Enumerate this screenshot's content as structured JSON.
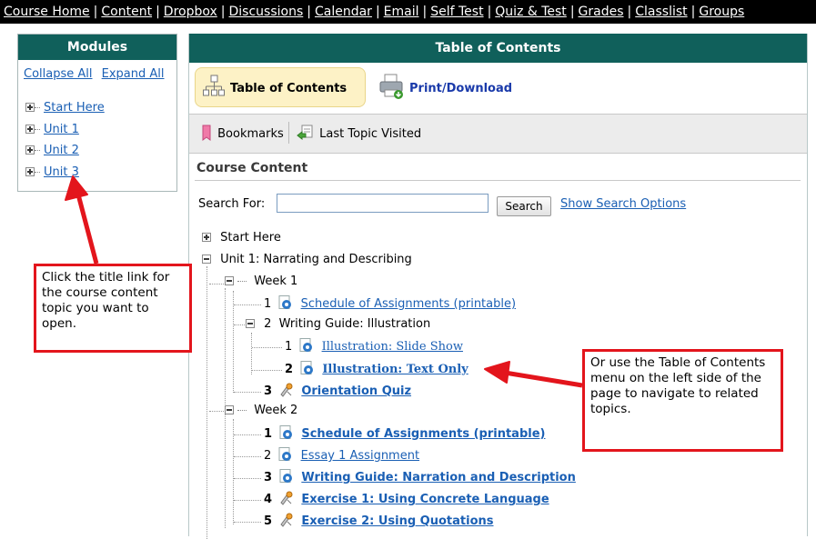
{
  "topnav": {
    "items": [
      "Course Home",
      "Content",
      "Dropbox",
      "Discussions",
      "Calendar",
      "Email",
      "Self Test",
      "Quiz & Test",
      "Grades",
      "Classlist",
      "Groups"
    ]
  },
  "modules": {
    "title": "Modules",
    "collapse_label": "Collapse All",
    "expand_label": "Expand All",
    "items": [
      "Start Here",
      "Unit 1",
      "Unit 2",
      "Unit 3"
    ]
  },
  "toc": {
    "title": "Table of Contents",
    "tab_active_label": "Table of Contents",
    "print_label": "Print/Download",
    "bookmarks_label": "Bookmarks",
    "last_topic_label": "Last Topic Visited",
    "section_title": "Course Content",
    "search_label": "Search For:",
    "search_value": "",
    "search_button": "Search",
    "search_options": "Show Search Options"
  },
  "tree": {
    "start_here": "Start Here",
    "unit1": "Unit 1: Narrating and Describing",
    "week1": "Week 1",
    "week1_items": [
      {
        "num": "1",
        "label": "Schedule of Assignments (printable)"
      },
      {
        "num": "2",
        "label": "Writing Guide: Illustration"
      }
    ],
    "illustration_items": [
      {
        "num": "1",
        "label": "Illustration: Slide Show"
      },
      {
        "num": "2",
        "label": "Illustration: Text Only"
      }
    ],
    "week1_item3": {
      "num": "3",
      "label": "Orientation Quiz"
    },
    "week2": "Week 2",
    "week2_items": [
      {
        "num": "1",
        "label": "Schedule of Assignments (printable)"
      },
      {
        "num": "2",
        "label": "Essay 1 Assignment"
      },
      {
        "num": "3",
        "label": "Writing Guide: Narration and Description"
      },
      {
        "num": "4",
        "label": "Exercise 1: Using Concrete Language"
      },
      {
        "num": "5",
        "label": "Exercise 2: Using Quotations"
      }
    ]
  },
  "callouts": {
    "left": "Click the title link for the course content topic you want to open.",
    "right": "Or use the Table of Contents menu on the left side of the page to navigate to related topics."
  },
  "colors": {
    "header_teal": "#10605b",
    "link_blue": "#1a5fb4",
    "annotation_red": "#e3151c"
  }
}
